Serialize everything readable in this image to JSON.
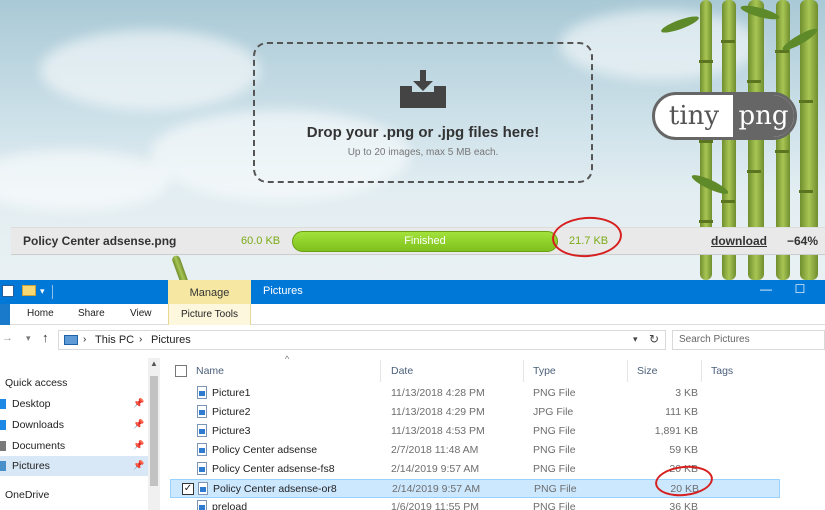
{
  "tinypng": {
    "drop_title": "Drop your .png or .jpg files here!",
    "drop_subtitle": "Up to 20 images, max 5 MB each.",
    "logo_left": "tiny",
    "logo_right": "png",
    "result": {
      "filename": "Policy Center adsense.png",
      "original_size": "60.0 KB",
      "status": "Finished",
      "progress": 1.0,
      "new_size": "21.7 KB",
      "download_label": "download",
      "savings": "−64%"
    }
  },
  "explorer": {
    "titlebar": {
      "manage_tab": "Manage",
      "title": "Pictures",
      "minimize": "—",
      "maximize": "☐"
    },
    "ribbon": {
      "tabs": [
        "Home",
        "Share",
        "View"
      ],
      "picture_tools": "Picture Tools"
    },
    "address": {
      "this_pc": "This PC",
      "folder": "Pictures",
      "separator": "›"
    },
    "search_placeholder": "Search Pictures",
    "nav": {
      "quick_access": "Quick access",
      "items": [
        {
          "label": "Desktop",
          "icon": "desktop-icon",
          "color": "#1e88e5"
        },
        {
          "label": "Downloads",
          "icon": "download-icon",
          "color": "#1e88e5"
        },
        {
          "label": "Documents",
          "icon": "documents-icon",
          "color": "#7a7a7a"
        },
        {
          "label": "Pictures",
          "icon": "pictures-icon",
          "color": "#4a90c8"
        }
      ],
      "onedrive": "OneDrive"
    },
    "columns": {
      "name": "Name",
      "date": "Date",
      "type": "Type",
      "size": "Size",
      "tags": "Tags"
    },
    "files": [
      {
        "name": "Picture1",
        "date": "11/13/2018 4:28 PM",
        "type": "PNG File",
        "size": "3 KB"
      },
      {
        "name": "Picture2",
        "date": "11/13/2018 4:29 PM",
        "type": "JPG File",
        "size": "111 KB"
      },
      {
        "name": "Picture3",
        "date": "11/13/2018 4:53 PM",
        "type": "PNG File",
        "size": "1,891 KB"
      },
      {
        "name": "Policy Center adsense",
        "date": "2/7/2018 11:48 AM",
        "type": "PNG File",
        "size": "59 KB"
      },
      {
        "name": "Policy Center adsense-fs8",
        "date": "2/14/2019 9:57 AM",
        "type": "PNG File",
        "size": "20 KB"
      },
      {
        "name": "Policy Center adsense-or8",
        "date": "2/14/2019 9:57 AM",
        "type": "PNG File",
        "size": "20 KB"
      },
      {
        "name": "preload",
        "date": "1/6/2019 11:55 PM",
        "type": "PNG File",
        "size": "36 KB"
      }
    ],
    "selected_check": "✓"
  }
}
